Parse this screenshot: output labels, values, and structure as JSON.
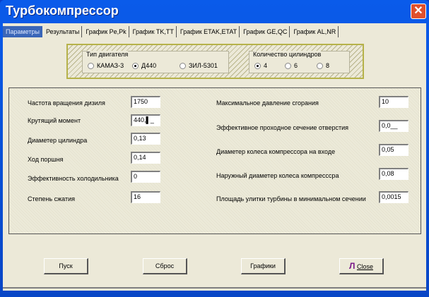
{
  "window": {
    "title": "Турбокомпрессор",
    "close": "✕"
  },
  "tabs": [
    "Параметры",
    "Результаты",
    "График Pe,Pk",
    "График TK,TT",
    "График ETAK,ETAT",
    "График GE,QC",
    "График AL,NR"
  ],
  "engine_type": {
    "legend": "Тип двигателя",
    "options": [
      "КАМАЗ-3",
      "Д440",
      "ЗИЛ-5301"
    ],
    "selected": "Д440"
  },
  "cylinders": {
    "legend": "Количество цилиндров",
    "options": [
      "4",
      "6",
      "8"
    ],
    "selected": "4"
  },
  "left_fields": [
    {
      "label": "Частота вращения дизиля",
      "value": "1750"
    },
    {
      "label": "Крутящий момент",
      "value": "440,▌_"
    },
    {
      "label": "Диаметер цилиндра",
      "value": "0,13"
    },
    {
      "label": "Ход поршня",
      "value": "0,14"
    },
    {
      "label": "Эффективность холодильника",
      "value": "0"
    },
    {
      "label": "Степень сжатия",
      "value": "16"
    }
  ],
  "right_fields": [
    {
      "label": "Максимальное давление сгорания",
      "value": "10"
    },
    {
      "label": "Эффективное проходное сечение отверстия",
      "value": "0,0__"
    },
    {
      "label": "Диаметер колеса компрессора на входе",
      "value": "0,05"
    },
    {
      "label": "Наружный диаметер колеса компресссра",
      "value": "0,08"
    },
    {
      "label": "Площадь улитки турбины в минимальном сечении",
      "value": "0,0015"
    }
  ],
  "buttons": {
    "start": "Пуск",
    "reset": "Сброс",
    "charts": "Графики",
    "close": "Close"
  }
}
